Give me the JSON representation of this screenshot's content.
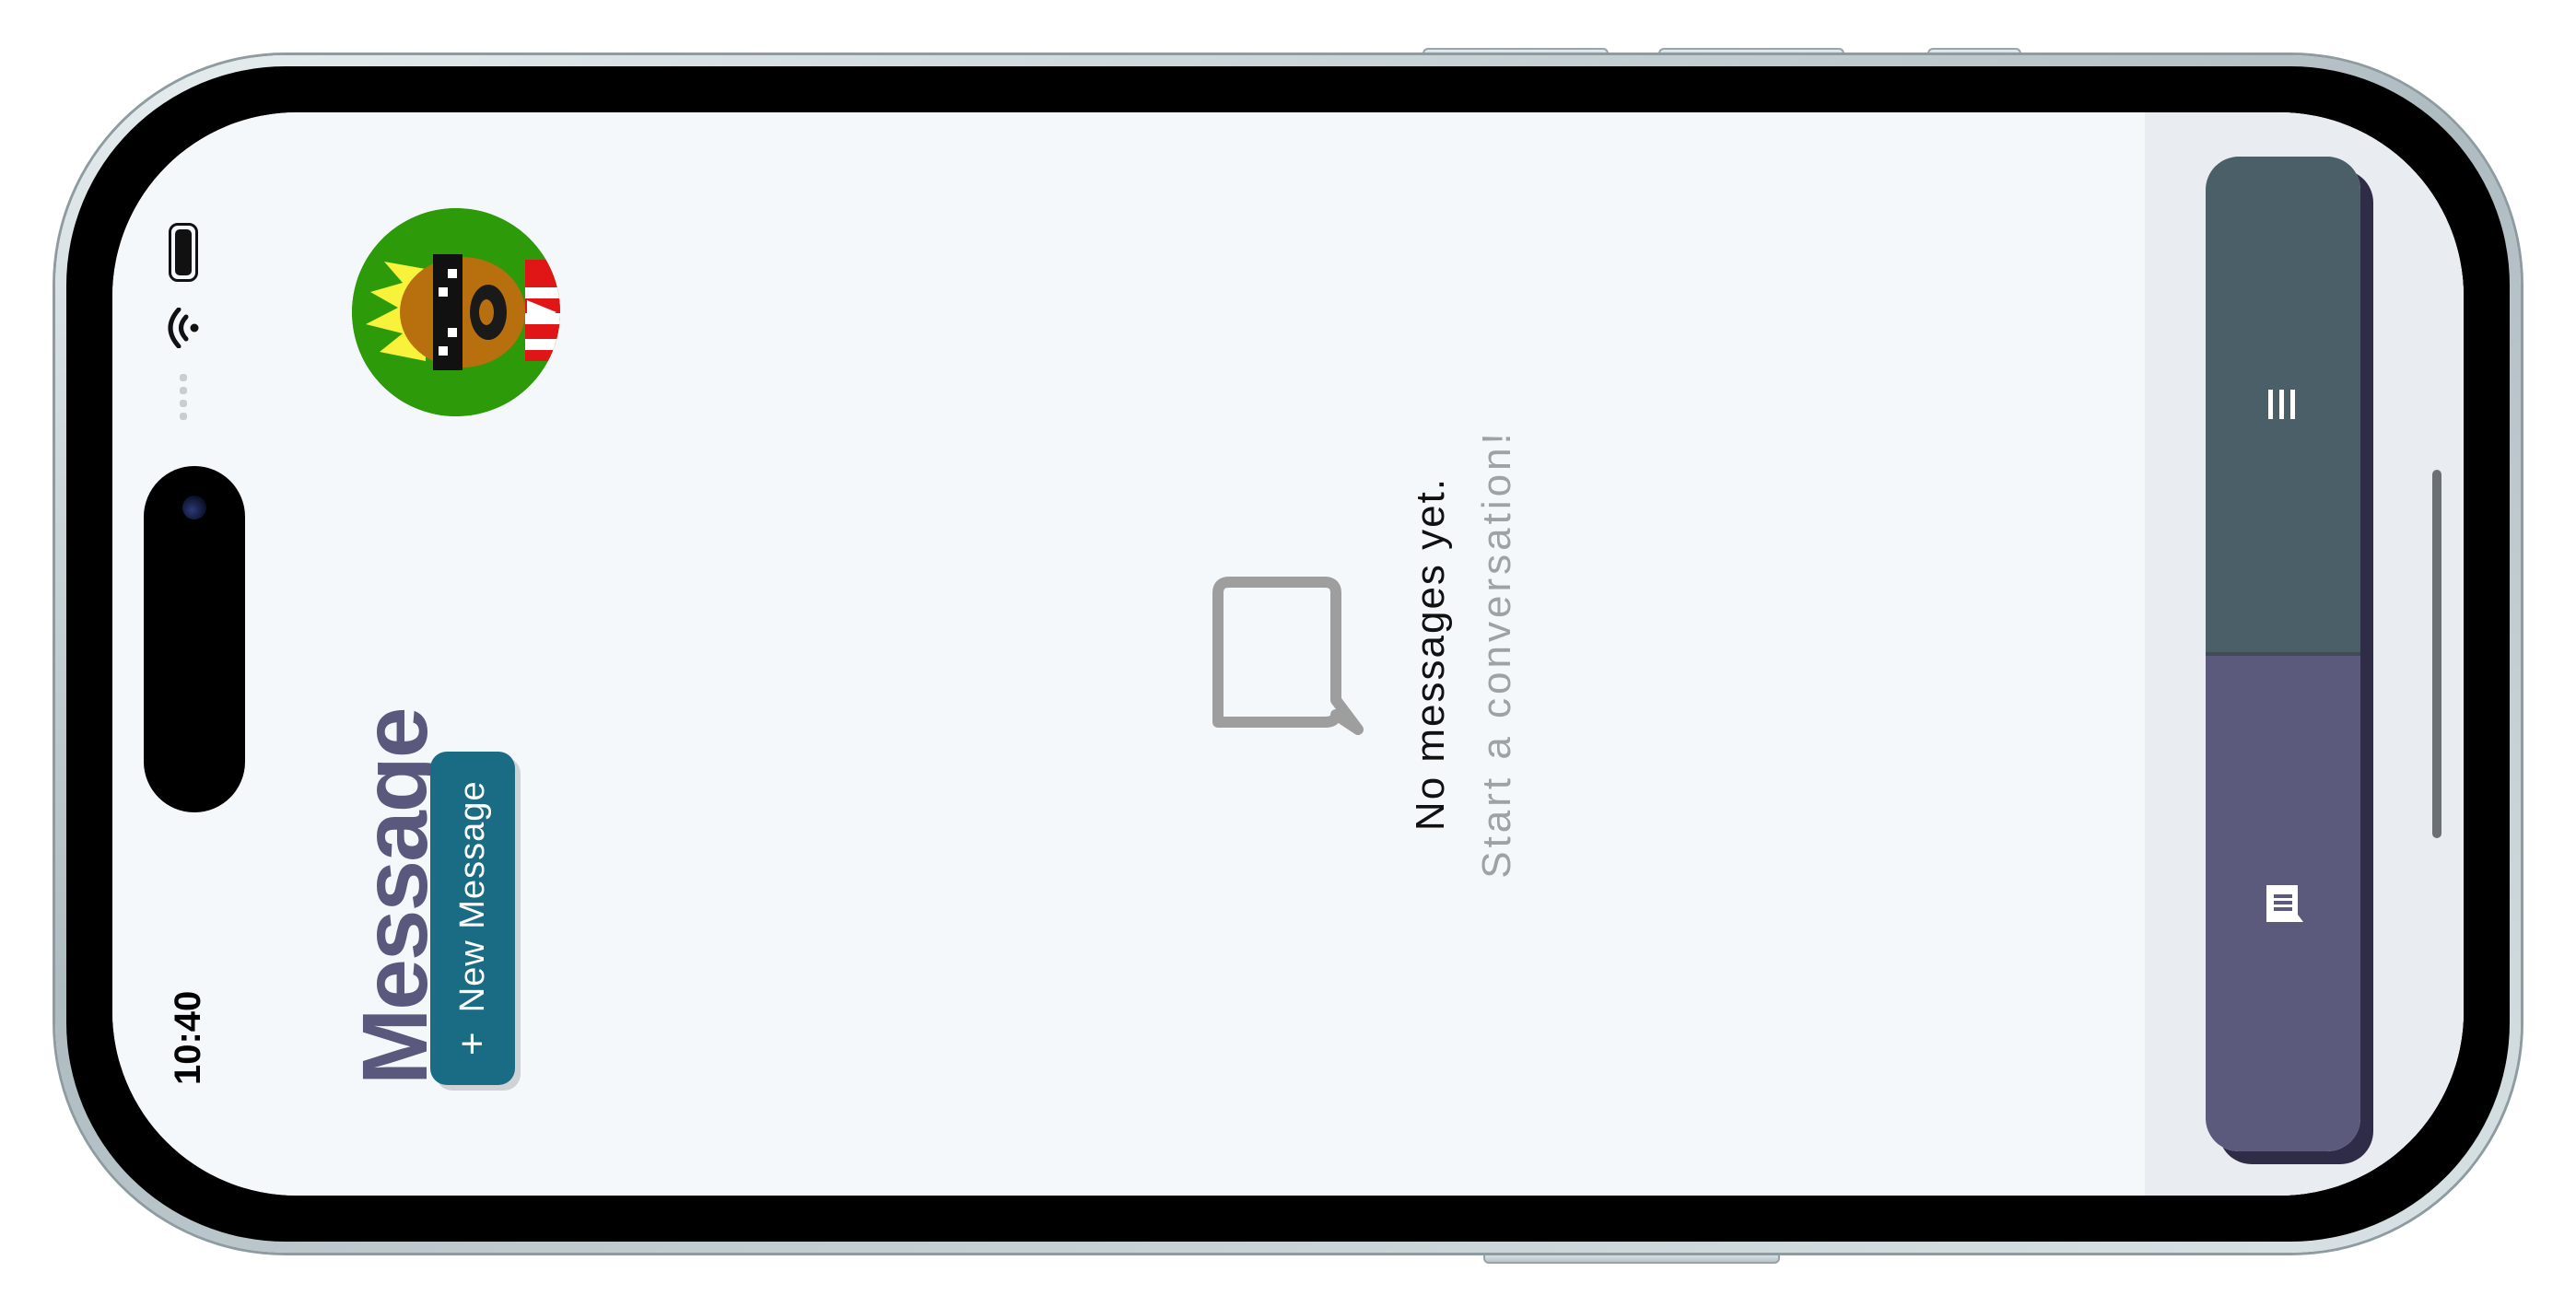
{
  "status": {
    "time": "10:40"
  },
  "header": {
    "title": "Message",
    "new_message_label": "New Message",
    "new_message_icon": "+"
  },
  "empty_state": {
    "title": "No messages yet.",
    "subtitle": "Start a conversation!"
  },
  "nav": {
    "items": [
      {
        "name": "messages",
        "icon": "chat-icon"
      },
      {
        "name": "menu",
        "icon": "menu-icon"
      }
    ]
  },
  "colors": {
    "title": "#5a587c",
    "button": "#1a6c85",
    "nav_messages": "#5c5a7c",
    "nav_menu": "#4b5f69",
    "avatar_bg": "#2c9a09",
    "screen_bg": "#f4f8fb"
  }
}
